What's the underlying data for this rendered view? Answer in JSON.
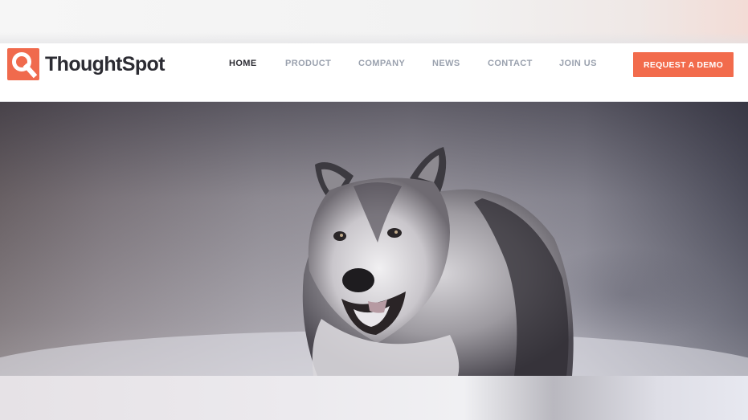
{
  "brand": {
    "name": "ThoughtSpot",
    "accent_color": "#f06a4d",
    "icon": "magnifier-logo-icon"
  },
  "nav": {
    "items": [
      {
        "label": "HOME",
        "active": true
      },
      {
        "label": "PRODUCT",
        "active": false
      },
      {
        "label": "COMPANY",
        "active": false
      },
      {
        "label": "NEWS",
        "active": false
      },
      {
        "label": "CONTACT",
        "active": false
      },
      {
        "label": "JOIN US",
        "active": false
      }
    ],
    "cta_label": "REQUEST A DEMO"
  },
  "hero": {
    "image": "wolf-photo"
  }
}
